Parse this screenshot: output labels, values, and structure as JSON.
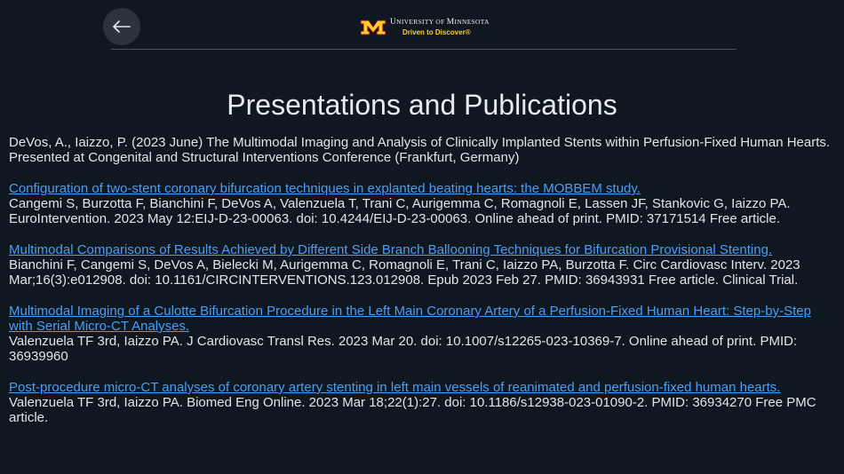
{
  "header": {
    "back_label": "Back",
    "logo": {
      "univ_first": "U",
      "univ_rest_1": "NIVERSITY OF ",
      "univ_mid": "M",
      "univ_rest_2": "INNESOTA",
      "tagline": "Driven to Discover®"
    },
    "colors": {
      "logo_maroon": "#7a0019",
      "logo_gold": "#ffcc33"
    }
  },
  "page_title": "Presentations and Publications",
  "entries": [
    {
      "link": "",
      "citation": "DeVos, A., Iaizzo, P. (2023 June) The Multimodal Imaging and Analysis of Clinically Implanted Stents within Perfusion-Fixed Human Hearts. Presented at Congenital and Structural Interventions Conference (Frankfurt, Germany)"
    },
    {
      "link": "Configuration of two-stent coronary bifurcation techniques in explanted beating hearts: the MOBBEM study.",
      "citation": "Cangemi S, Burzotta F, Bianchini F, DeVos A, Valenzuela T, Trani C, Aurigemma C, Romagnoli E, Lassen JF, Stankovic G, Iaizzo PA. EuroIntervention. 2023 May 12:EIJ-D-23-00063. doi: 10.4244/EIJ-D-23-00063. Online ahead of print. PMID: 37171514 Free article."
    },
    {
      "link": "Multimodal Comparisons of Results Achieved by Different Side Branch Ballooning Techniques for Bifurcation Provisional Stenting.",
      "citation": "Bianchini F, Cangemi S, DeVos A, Bielecki M, Aurigemma C, Romagnoli E, Trani C, Iaizzo PA, Burzotta F. Circ Cardiovasc Interv. 2023 Mar;16(3):e012908. doi: 10.1161/CIRCINTERVENTIONS.123.012908. Epub 2023 Feb 27. PMID: 36943931 Free article. Clinical Trial."
    },
    {
      "link": "Multimodal Imaging of a Culotte Bifurcation Procedure in the Left Main Coronary Artery of a Perfusion-Fixed Human Heart: Step-by-Step with Serial Micro-CT Analyses.",
      "citation": "Valenzuela TF 3rd, Iaizzo PA. J Cardiovasc Transl Res. 2023 Mar 20. doi: 10.1007/s12265-023-10369-7. Online ahead of print. PMID: 36939960"
    },
    {
      "link": "Post-procedure micro-CT analyses of coronary artery stenting in left main vessels of reanimated and perfusion-fixed human hearts.",
      "citation": "Valenzuela TF 3rd, Iaizzo PA. Biomed Eng Online. 2023 Mar 18;22(1):27. doi: 10.1186/s12938-023-01090-2. PMID: 36934270 Free PMC article."
    }
  ]
}
